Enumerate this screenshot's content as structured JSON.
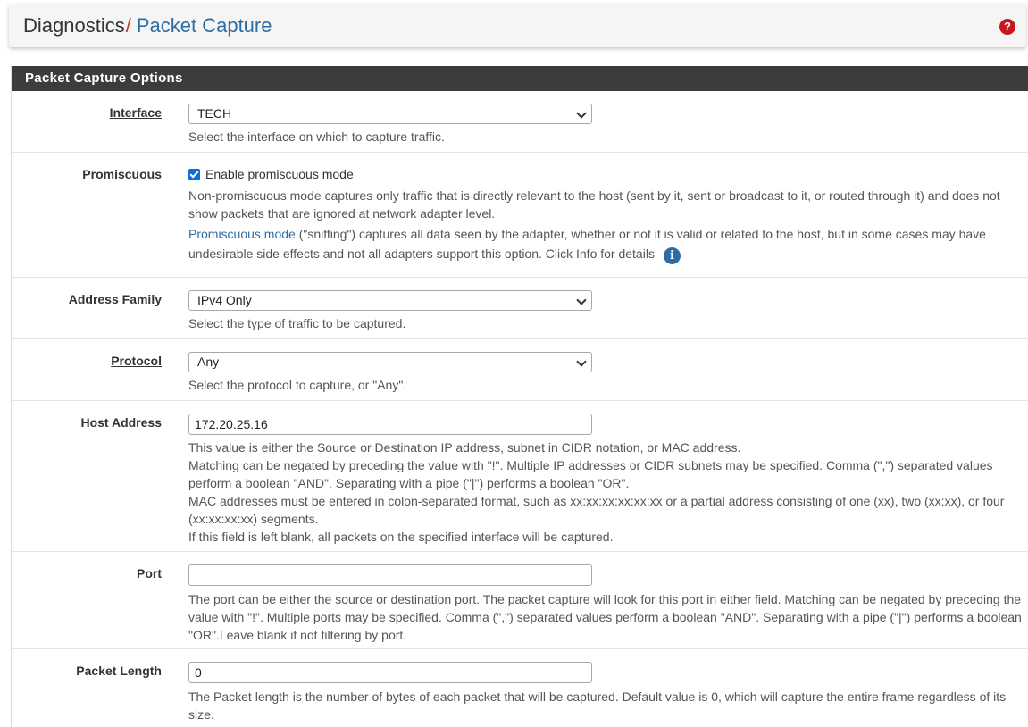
{
  "breadcrumb": {
    "root": "Diagnostics",
    "separator": "/",
    "current": "Packet Capture"
  },
  "help_icon": "question-circle-icon",
  "panel": {
    "title": "Packet Capture Options"
  },
  "fields": {
    "interface": {
      "label": "Interface",
      "value": "TECH",
      "help": "Select the interface on which to capture traffic."
    },
    "promiscuous": {
      "label": "Promiscuous",
      "checkbox_label": "Enable promiscuous mode",
      "checked": true,
      "help1": "Non-promiscuous mode captures only traffic that is directly relevant to the host (sent by it, sent or broadcast to it, or routed through it) and does not show packets that are ignored at network adapter level.",
      "help2_link": "Promiscuous mode",
      "help2_rest": " (\"sniffing\") captures all data seen by the adapter, whether or not it is valid or related to the host, but in some cases may have undesirable side effects and not all adapters support this option. Click Info for details",
      "info_icon": "info-circle-icon"
    },
    "address_family": {
      "label": "Address Family",
      "value": "IPv4 Only",
      "help": "Select the type of traffic to be captured."
    },
    "protocol": {
      "label": "Protocol",
      "value": "Any",
      "help": "Select the protocol to capture, or \"Any\"."
    },
    "host_address": {
      "label": "Host Address",
      "value": "172.20.25.16",
      "help1": "This value is either the Source or Destination IP address, subnet in CIDR notation, or MAC address.",
      "help2": "Matching can be negated by preceding the value with \"!\". Multiple IP addresses or CIDR subnets may be specified. Comma (\",\") separated values perform a boolean \"AND\". Separating with a pipe (\"|\") performs a boolean \"OR\".",
      "help3": "MAC addresses must be entered in colon-separated format, such as xx:xx:xx:xx:xx:xx or a partial address consisting of one (xx), two (xx:xx), or four (xx:xx:xx:xx) segments.",
      "help4": "If this field is left blank, all packets on the specified interface will be captured."
    },
    "port": {
      "label": "Port",
      "value": "",
      "help": "The port can be either the source or destination port. The packet capture will look for this port in either field. Matching can be negated by preceding the value with \"!\". Multiple ports may be specified. Comma (\",\") separated values perform a boolean \"AND\". Separating with a pipe (\"|\") performs a boolean \"OR\".Leave blank if not filtering by port."
    },
    "packet_length": {
      "label": "Packet Length",
      "value": "0",
      "help": "The Packet length is the number of bytes of each packet that will be captured. Default value is 0, which will capture the entire frame regardless of its size."
    }
  }
}
